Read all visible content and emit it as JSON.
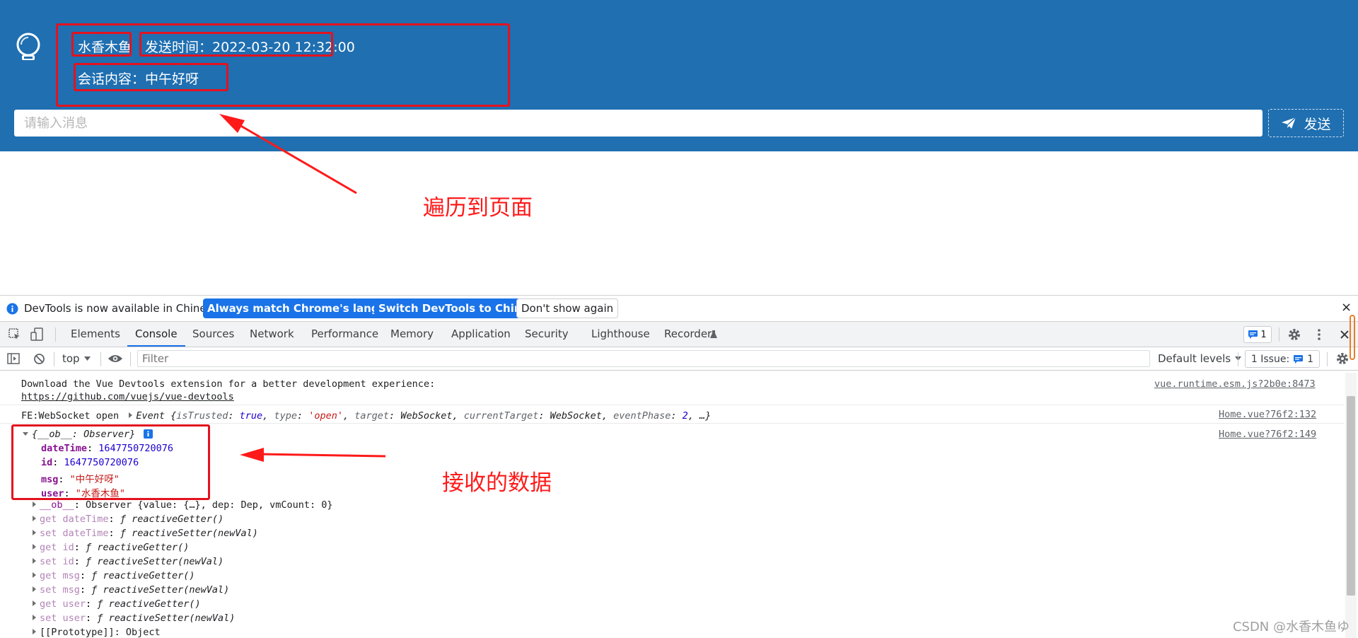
{
  "app": {
    "user_name": "水香木鱼",
    "send_time_label": "发送时间：",
    "send_time_value": "2022-03-20 12:32:00",
    "message_content": "会话内容：中午好呀",
    "input_placeholder": "请输入消息",
    "send_button_label": "发送"
  },
  "annotations": {
    "render_to_page": "遍历到页面",
    "received_data": "接收的数据"
  },
  "infobar": {
    "message": "DevTools is now available in Chinese!",
    "match_language_button": "Always match Chrome's language",
    "switch_button": "Switch DevTools to Chinese",
    "dismiss_button": "Don't show again",
    "close_label": "×"
  },
  "devtools_tabs": [
    "Elements",
    "Console",
    "Sources",
    "Network",
    "Performance",
    "Memory",
    "Application",
    "Security",
    "Lighthouse",
    "Recorder"
  ],
  "active_tab": "Console",
  "toolbar": {
    "issues_count": "1"
  },
  "filterbar": {
    "context": "top",
    "filter_placeholder": "Filter",
    "levels": "Default levels",
    "issues_label": "1 Issue:",
    "issues_count": "1"
  },
  "console": {
    "line1_text": "Download the Vue Devtools extension for a better development experience:",
    "line1_link": "https://github.com/vuejs/vue-devtools",
    "line1_source": "vue.runtime.esm.js?2b0e:8473",
    "line2_prefix": "FE:WebSocket open",
    "line2_event": "Event",
    "line2_body_pre": "{",
    "line2_k1": "isTrusted",
    "line2_v1": "true",
    "line2_k2": "type",
    "line2_v2": "'open'",
    "line2_k3": "target",
    "line2_v3": "WebSocket",
    "line2_k4": "currentTarget",
    "line2_v4": "WebSocket",
    "line2_k5": "eventPhase",
    "line2_v5": "2",
    "line2_tail": ", …}",
    "line2_source": "Home.vue?76f2:132",
    "obj_header": "{__ob__: Observer}",
    "obj_source": "Home.vue?76f2:149",
    "props": [
      {
        "key": "dateTime",
        "value": "1647750720076",
        "kind": "num"
      },
      {
        "key": "id",
        "value": "1647750720076",
        "kind": "num"
      },
      {
        "key": "msg",
        "value": "\"中午好呀\"",
        "kind": "str"
      },
      {
        "key": "user",
        "value": "\"水香木鱼\"",
        "kind": "str"
      }
    ],
    "ob_line_key": "__ob__",
    "ob_line_val": "Observer {value: {…}, dep: Dep, vmCount: 0}",
    "accessors": [
      {
        "label": "get dateTime",
        "fn": "reactiveGetter()"
      },
      {
        "label": "set dateTime",
        "fn": "reactiveSetter(newVal)"
      },
      {
        "label": "get id",
        "fn": "reactiveGetter()"
      },
      {
        "label": "set id",
        "fn": "reactiveSetter(newVal)"
      },
      {
        "label": "get msg",
        "fn": "reactiveGetter()"
      },
      {
        "label": "set msg",
        "fn": "reactiveSetter(newVal)"
      },
      {
        "label": "get user",
        "fn": "reactiveGetter()"
      },
      {
        "label": "set user",
        "fn": "reactiveSetter(newVal)"
      }
    ],
    "prototype_line": "[[Prototype]]: Object"
  },
  "watermark": "CSDN @水香木鱼ゆ",
  "colors": {
    "header_bg": "#1f6fb1",
    "annotation_red": "#ff1a1a",
    "devtools_blue": "#1a73e8"
  }
}
